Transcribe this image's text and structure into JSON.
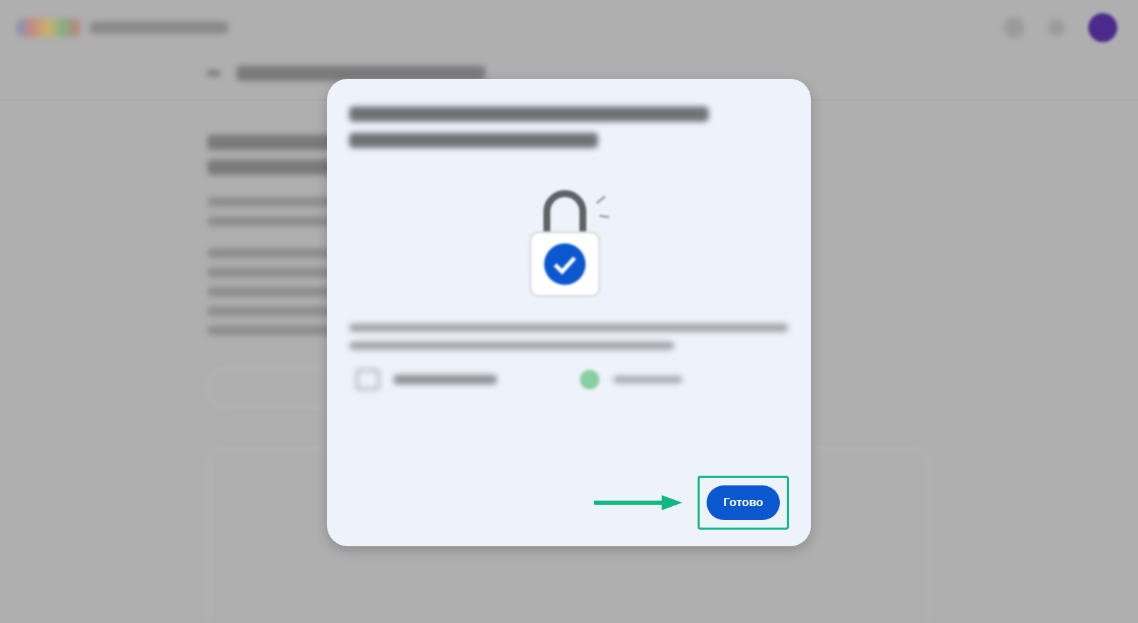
{
  "dialog": {
    "done_button": {
      "label": "Готово",
      "highlighted": true
    }
  }
}
